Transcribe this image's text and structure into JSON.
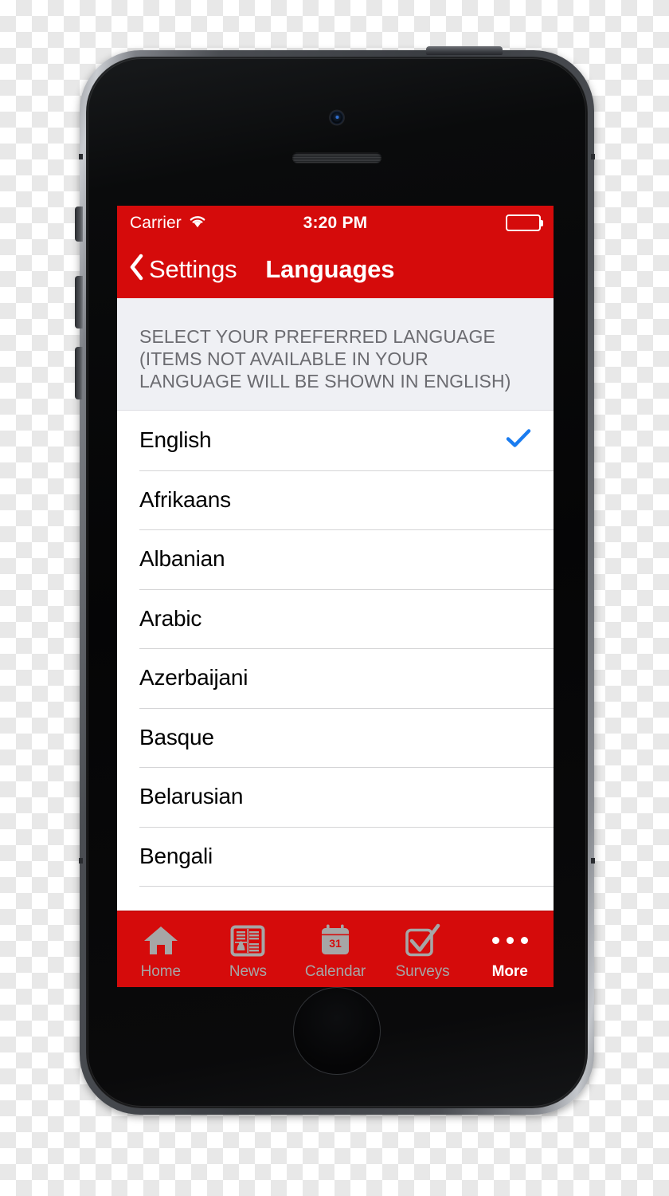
{
  "device": {
    "name": "iphone-5s-space-gray",
    "hardware": {
      "camera": "front-camera",
      "speaker": "earpiece-speaker",
      "home_button": "home-button",
      "power_button": "power-button",
      "silent_switch": "silent-switch",
      "volume_up": "volume-up-button",
      "volume_down": "volume-down-button"
    }
  },
  "colors": {
    "brand_red": "#d50b0b",
    "accent_blue": "#1a7cf0",
    "section_bg": "#eff0f4",
    "section_text": "#6b6b70",
    "tab_inactive": "#a6a6a6",
    "tab_active": "#ffffff",
    "separator": "#d4d4d6"
  },
  "status_bar": {
    "carrier": "Carrier",
    "wifi_icon": "wifi-icon",
    "time": "3:20 PM",
    "battery_icon": "battery-icon"
  },
  "nav_bar": {
    "back_icon": "chevron-left-icon",
    "back_label": "Settings",
    "title": "Languages"
  },
  "section": {
    "header": "SELECT YOUR PREFERRED LANGUAGE (ITEMS NOT AVAILABLE IN YOUR LANGUAGE WILL BE SHOWN IN ENGLISH)"
  },
  "languages": [
    {
      "label": "English",
      "selected": true,
      "check_icon": "checkmark-icon"
    },
    {
      "label": "Afrikaans",
      "selected": false,
      "check_icon": ""
    },
    {
      "label": "Albanian",
      "selected": false,
      "check_icon": ""
    },
    {
      "label": "Arabic",
      "selected": false,
      "check_icon": ""
    },
    {
      "label": "Azerbaijani",
      "selected": false,
      "check_icon": ""
    },
    {
      "label": "Basque",
      "selected": false,
      "check_icon": ""
    },
    {
      "label": "Belarusian",
      "selected": false,
      "check_icon": ""
    },
    {
      "label": "Bengali",
      "selected": false,
      "check_icon": ""
    }
  ],
  "tab_bar": {
    "items": [
      {
        "label": "Home",
        "icon": "home-icon",
        "active": false
      },
      {
        "label": "News",
        "icon": "newspaper-icon",
        "active": false
      },
      {
        "label": "Calendar",
        "icon": "calendar-icon",
        "active": false,
        "badge": "31"
      },
      {
        "label": "Surveys",
        "icon": "checkbox-icon",
        "active": false
      },
      {
        "label": "More",
        "icon": "ellipsis-icon",
        "active": true
      }
    ]
  }
}
